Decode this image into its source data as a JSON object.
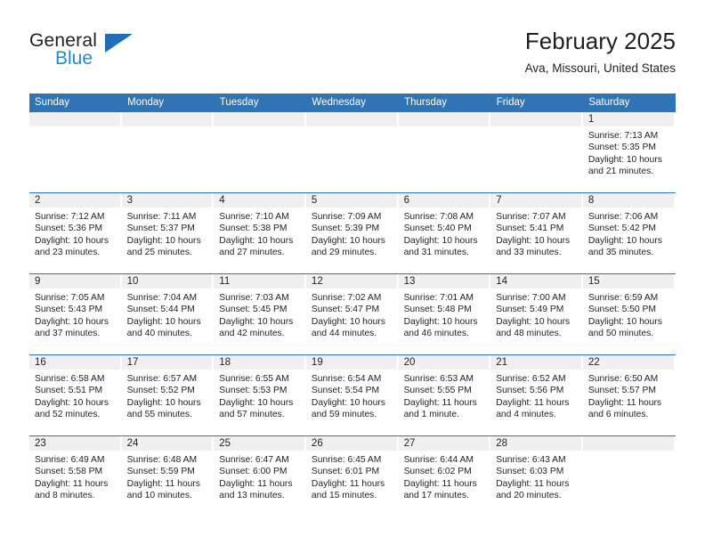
{
  "brand": {
    "name_part1": "General",
    "name_part2": "Blue",
    "triangle_icon": "triangle-icon",
    "accent_dark_blue": "#1f6fb8",
    "accent_light_blue": "#1f8ad6"
  },
  "header": {
    "title": "February 2025",
    "subtitle": "Ava, Missouri, United States",
    "header_bg": "#2f74b5",
    "header_text_color": "#ffffff",
    "daynum_strip_bg": "#f0f0f0"
  },
  "columns": [
    "Sunday",
    "Monday",
    "Tuesday",
    "Wednesday",
    "Thursday",
    "Friday",
    "Saturday"
  ],
  "labels": {
    "sunrise_prefix": "Sunrise: ",
    "sunset_prefix": "Sunset: ",
    "daylight_prefix": "Daylight: "
  },
  "weeks": [
    [
      {
        "day": "",
        "sunrise": "",
        "sunset": "",
        "daylight": ""
      },
      {
        "day": "",
        "sunrise": "",
        "sunset": "",
        "daylight": ""
      },
      {
        "day": "",
        "sunrise": "",
        "sunset": "",
        "daylight": ""
      },
      {
        "day": "",
        "sunrise": "",
        "sunset": "",
        "daylight": ""
      },
      {
        "day": "",
        "sunrise": "",
        "sunset": "",
        "daylight": ""
      },
      {
        "day": "",
        "sunrise": "",
        "sunset": "",
        "daylight": ""
      },
      {
        "day": "1",
        "sunrise": "Sunrise: 7:13 AM",
        "sunset": "Sunset: 5:35 PM",
        "daylight": "Daylight: 10 hours and 21 minutes."
      }
    ],
    [
      {
        "day": "2",
        "sunrise": "Sunrise: 7:12 AM",
        "sunset": "Sunset: 5:36 PM",
        "daylight": "Daylight: 10 hours and 23 minutes."
      },
      {
        "day": "3",
        "sunrise": "Sunrise: 7:11 AM",
        "sunset": "Sunset: 5:37 PM",
        "daylight": "Daylight: 10 hours and 25 minutes."
      },
      {
        "day": "4",
        "sunrise": "Sunrise: 7:10 AM",
        "sunset": "Sunset: 5:38 PM",
        "daylight": "Daylight: 10 hours and 27 minutes."
      },
      {
        "day": "5",
        "sunrise": "Sunrise: 7:09 AM",
        "sunset": "Sunset: 5:39 PM",
        "daylight": "Daylight: 10 hours and 29 minutes."
      },
      {
        "day": "6",
        "sunrise": "Sunrise: 7:08 AM",
        "sunset": "Sunset: 5:40 PM",
        "daylight": "Daylight: 10 hours and 31 minutes."
      },
      {
        "day": "7",
        "sunrise": "Sunrise: 7:07 AM",
        "sunset": "Sunset: 5:41 PM",
        "daylight": "Daylight: 10 hours and 33 minutes."
      },
      {
        "day": "8",
        "sunrise": "Sunrise: 7:06 AM",
        "sunset": "Sunset: 5:42 PM",
        "daylight": "Daylight: 10 hours and 35 minutes."
      }
    ],
    [
      {
        "day": "9",
        "sunrise": "Sunrise: 7:05 AM",
        "sunset": "Sunset: 5:43 PM",
        "daylight": "Daylight: 10 hours and 37 minutes."
      },
      {
        "day": "10",
        "sunrise": "Sunrise: 7:04 AM",
        "sunset": "Sunset: 5:44 PM",
        "daylight": "Daylight: 10 hours and 40 minutes."
      },
      {
        "day": "11",
        "sunrise": "Sunrise: 7:03 AM",
        "sunset": "Sunset: 5:45 PM",
        "daylight": "Daylight: 10 hours and 42 minutes."
      },
      {
        "day": "12",
        "sunrise": "Sunrise: 7:02 AM",
        "sunset": "Sunset: 5:47 PM",
        "daylight": "Daylight: 10 hours and 44 minutes."
      },
      {
        "day": "13",
        "sunrise": "Sunrise: 7:01 AM",
        "sunset": "Sunset: 5:48 PM",
        "daylight": "Daylight: 10 hours and 46 minutes."
      },
      {
        "day": "14",
        "sunrise": "Sunrise: 7:00 AM",
        "sunset": "Sunset: 5:49 PM",
        "daylight": "Daylight: 10 hours and 48 minutes."
      },
      {
        "day": "15",
        "sunrise": "Sunrise: 6:59 AM",
        "sunset": "Sunset: 5:50 PM",
        "daylight": "Daylight: 10 hours and 50 minutes."
      }
    ],
    [
      {
        "day": "16",
        "sunrise": "Sunrise: 6:58 AM",
        "sunset": "Sunset: 5:51 PM",
        "daylight": "Daylight: 10 hours and 52 minutes."
      },
      {
        "day": "17",
        "sunrise": "Sunrise: 6:57 AM",
        "sunset": "Sunset: 5:52 PM",
        "daylight": "Daylight: 10 hours and 55 minutes."
      },
      {
        "day": "18",
        "sunrise": "Sunrise: 6:55 AM",
        "sunset": "Sunset: 5:53 PM",
        "daylight": "Daylight: 10 hours and 57 minutes."
      },
      {
        "day": "19",
        "sunrise": "Sunrise: 6:54 AM",
        "sunset": "Sunset: 5:54 PM",
        "daylight": "Daylight: 10 hours and 59 minutes."
      },
      {
        "day": "20",
        "sunrise": "Sunrise: 6:53 AM",
        "sunset": "Sunset: 5:55 PM",
        "daylight": "Daylight: 11 hours and 1 minute."
      },
      {
        "day": "21",
        "sunrise": "Sunrise: 6:52 AM",
        "sunset": "Sunset: 5:56 PM",
        "daylight": "Daylight: 11 hours and 4 minutes."
      },
      {
        "day": "22",
        "sunrise": "Sunrise: 6:50 AM",
        "sunset": "Sunset: 5:57 PM",
        "daylight": "Daylight: 11 hours and 6 minutes."
      }
    ],
    [
      {
        "day": "23",
        "sunrise": "Sunrise: 6:49 AM",
        "sunset": "Sunset: 5:58 PM",
        "daylight": "Daylight: 11 hours and 8 minutes."
      },
      {
        "day": "24",
        "sunrise": "Sunrise: 6:48 AM",
        "sunset": "Sunset: 5:59 PM",
        "daylight": "Daylight: 11 hours and 10 minutes."
      },
      {
        "day": "25",
        "sunrise": "Sunrise: 6:47 AM",
        "sunset": "Sunset: 6:00 PM",
        "daylight": "Daylight: 11 hours and 13 minutes."
      },
      {
        "day": "26",
        "sunrise": "Sunrise: 6:45 AM",
        "sunset": "Sunset: 6:01 PM",
        "daylight": "Daylight: 11 hours and 15 minutes."
      },
      {
        "day": "27",
        "sunrise": "Sunrise: 6:44 AM",
        "sunset": "Sunset: 6:02 PM",
        "daylight": "Daylight: 11 hours and 17 minutes."
      },
      {
        "day": "28",
        "sunrise": "Sunrise: 6:43 AM",
        "sunset": "Sunset: 6:03 PM",
        "daylight": "Daylight: 11 hours and 20 minutes."
      },
      {
        "day": "",
        "sunrise": "",
        "sunset": "",
        "daylight": ""
      }
    ]
  ]
}
